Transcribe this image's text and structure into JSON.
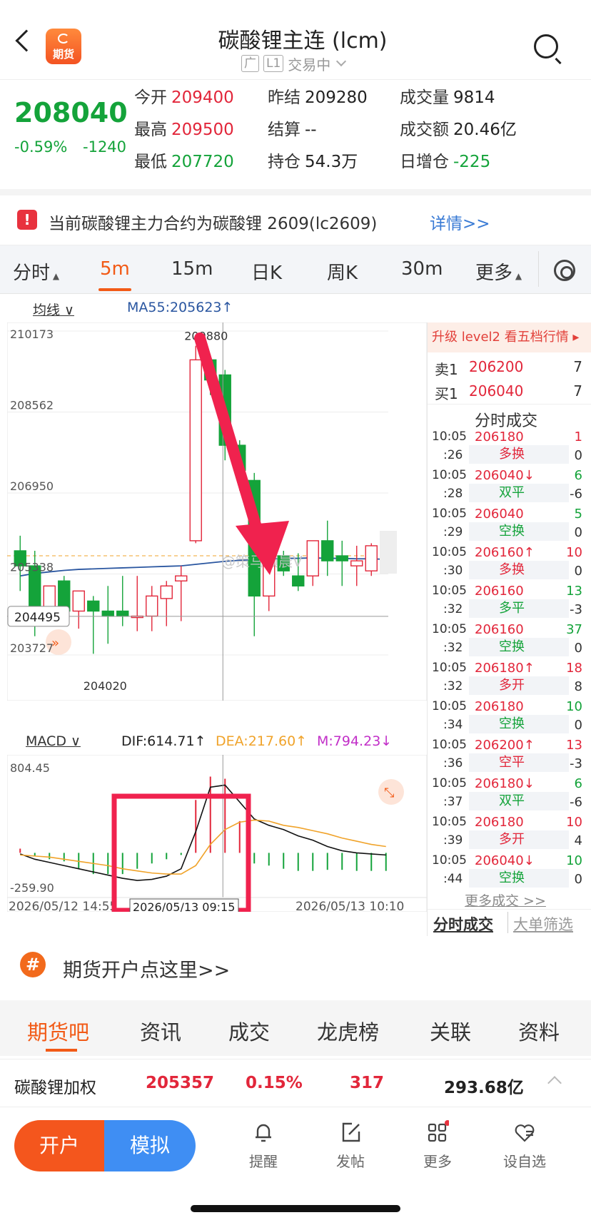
{
  "header": {
    "title": "碳酸锂主连 (lcm)",
    "logo_text": "期货",
    "tag_exchange": "广",
    "tag_level": "L1",
    "status": "交易中"
  },
  "quote": {
    "price": "208040",
    "change_pct": "-0.59%",
    "change_abs": "-1240",
    "open_label": "今开",
    "open": "209400",
    "high_label": "最高",
    "high": "209500",
    "low_label": "最低",
    "low": "207720",
    "prev_label": "昨结",
    "prev": "209280",
    "settle_label": "结算",
    "settle": "--",
    "oi_label": "持仓",
    "oi": "54.3万",
    "vol_label": "成交量",
    "vol": "9814",
    "amount_label": "成交额",
    "amount": "20.46亿",
    "oi_change_label": "日增仓",
    "oi_change": "-225"
  },
  "notice": {
    "text": "当前碳酸锂主力合约为碳酸锂 2609(lc2609)",
    "link": "详情>>"
  },
  "tabs": [
    "分时",
    "5m",
    "15m",
    "日K",
    "周K",
    "30m",
    "更多"
  ],
  "active_tab": "5m",
  "indicators": {
    "ma_label": "均线",
    "ma_value": "MA55:205623↑",
    "macd_label": "MACD",
    "dif": "DIF:614.71↑",
    "dea": "DEA:217.60↑",
    "m": "M:794.23↓"
  },
  "chart_data": {
    "type": "candlestick",
    "y_ticks": [
      "210173",
      "208562",
      "206950",
      "205338",
      "203727"
    ],
    "high_label": "209880",
    "low_label": "204020",
    "cursor_price": "204495",
    "macd_ticks": [
      "804.45",
      "-259.90"
    ],
    "x_labels": [
      "2026/05/12 14:55",
      "2026/05/13 10:10"
    ],
    "cursor_time": "2026/05/13 09:15",
    "watermark": "@策马巅晨V",
    "ylim": [
      203727,
      210173
    ],
    "candles": [
      {
        "o": 205800,
        "h": 206100,
        "c": 205500,
        "l": 205000
      },
      {
        "o": 205500,
        "h": 205800,
        "c": 204500,
        "l": 204100
      },
      {
        "o": 204500,
        "h": 205100,
        "c": 205100,
        "l": 204300
      },
      {
        "o": 205200,
        "h": 205300,
        "c": 204600,
        "l": 204300
      },
      {
        "o": 204600,
        "h": 204850,
        "c": 205000,
        "l": 204250
      },
      {
        "o": 204800,
        "h": 204900,
        "c": 204600,
        "l": 203750
      },
      {
        "o": 204600,
        "h": 205100,
        "c": 204500,
        "l": 203950
      },
      {
        "o": 204600,
        "h": 205300,
        "c": 204500,
        "l": 204300
      },
      {
        "o": 204500,
        "h": 205300,
        "c": 204500,
        "l": 204200
      },
      {
        "o": 204500,
        "h": 205100,
        "c": 204900,
        "l": 204200
      },
      {
        "o": 204850,
        "h": 205200,
        "c": 205100,
        "l": 204300
      },
      {
        "o": 205200,
        "h": 205500,
        "c": 205300,
        "l": 204400
      },
      {
        "o": 206000,
        "h": 209880,
        "c": 209600,
        "l": 205950
      },
      {
        "o": 209600,
        "h": 209700,
        "c": 209200,
        "l": 208900
      },
      {
        "o": 209300,
        "h": 209400,
        "c": 207900,
        "l": 207600
      },
      {
        "o": 207900,
        "h": 208000,
        "c": 207400,
        "l": 207000
      },
      {
        "o": 207200,
        "h": 207350,
        "c": 204900,
        "l": 204100
      },
      {
        "o": 204900,
        "h": 205800,
        "c": 205750,
        "l": 204600
      },
      {
        "o": 205700,
        "h": 205800,
        "c": 205400,
        "l": 205300
      },
      {
        "o": 205300,
        "h": 205750,
        "c": 205100,
        "l": 205000
      },
      {
        "o": 205300,
        "h": 206000,
        "c": 206000,
        "l": 205100
      },
      {
        "o": 206000,
        "h": 206400,
        "c": 205600,
        "l": 205300
      },
      {
        "o": 205700,
        "h": 206000,
        "c": 205600,
        "l": 205100
      },
      {
        "o": 205500,
        "h": 205900,
        "c": 205600,
        "l": 205100
      },
      {
        "o": 205400,
        "h": 205950,
        "c": 205900,
        "l": 205300
      },
      {
        "o": 205900,
        "h": 206000,
        "c": 205700,
        "l": 205600
      }
    ],
    "ma55": [
      205300,
      205350,
      205380,
      205410,
      205430,
      205440,
      205450,
      205460,
      205470,
      205480,
      205490,
      205500,
      205530,
      205560,
      205590,
      205610,
      205625,
      205640,
      205650,
      205650,
      205660,
      205650,
      205650,
      205640,
      205640,
      205630
    ],
    "macd_ylim": [
      -259.9,
      804.45
    ],
    "dif": [
      -10,
      -60,
      -90,
      -120,
      -150,
      -180,
      -210,
      -240,
      -260,
      -250,
      -220,
      -150,
      200,
      620,
      640,
      480,
      320,
      260,
      220,
      160,
      120,
      60,
      20,
      0,
      -10,
      -20
    ],
    "dea": [
      -20,
      -30,
      -40,
      -60,
      -80,
      -100,
      -120,
      -150,
      -170,
      -190,
      -200,
      -200,
      -120,
      80,
      220,
      290,
      310,
      300,
      260,
      240,
      210,
      180,
      140,
      110,
      80,
      60
    ],
    "macd_bars": [
      40,
      -30,
      -60,
      -80,
      -150,
      -200,
      -200,
      -200,
      -150,
      -100,
      -60,
      -20,
      500,
      720,
      700,
      300,
      -100,
      -120,
      -150,
      -170,
      -170,
      -160,
      -160,
      -170,
      -170,
      -170
    ]
  },
  "side": {
    "upgrade": "升级 level2 看五档行情 ▸",
    "sell_label": "卖1",
    "sell_price": "206200",
    "sell_vol": "7",
    "buy_label": "买1",
    "buy_price": "206040",
    "buy_vol": "7",
    "trades_title": "分时成交",
    "trades": [
      {
        "time": "10:05",
        "sec": ":26",
        "price": "206180",
        "vol": "1",
        "type": "多换",
        "chg": "0",
        "vol_color": "red",
        "type_color": "red"
      },
      {
        "time": "10:05",
        "sec": ":28",
        "price": "206040↓",
        "vol": "6",
        "type": "双平",
        "chg": "-6",
        "vol_color": "green",
        "type_color": "green"
      },
      {
        "time": "10:05",
        "sec": ":29",
        "price": "206040",
        "vol": "5",
        "type": "空换",
        "chg": "0",
        "vol_color": "green",
        "type_color": "green"
      },
      {
        "time": "10:05",
        "sec": ":30",
        "price": "206160↑",
        "vol": "10",
        "type": "多换",
        "chg": "0",
        "vol_color": "red",
        "type_color": "red"
      },
      {
        "time": "10:05",
        "sec": ":32",
        "price": "206160",
        "vol": "13",
        "type": "多平",
        "chg": "-3",
        "vol_color": "green",
        "type_color": "green"
      },
      {
        "time": "10:05",
        "sec": ":32",
        "price": "206160",
        "vol": "37",
        "type": "空换",
        "chg": "0",
        "vol_color": "green",
        "type_color": "green"
      },
      {
        "time": "10:05",
        "sec": ":32",
        "price": "206180↑",
        "vol": "18",
        "type": "多开",
        "chg": "8",
        "vol_color": "red",
        "type_color": "red"
      },
      {
        "time": "10:05",
        "sec": ":34",
        "price": "206180",
        "vol": "10",
        "type": "空换",
        "chg": "0",
        "vol_color": "green",
        "type_color": "green"
      },
      {
        "time": "10:05",
        "sec": ":36",
        "price": "206200↑",
        "vol": "13",
        "type": "空平",
        "chg": "-3",
        "vol_color": "red",
        "type_color": "red"
      },
      {
        "time": "10:05",
        "sec": ":37",
        "price": "206180↓",
        "vol": "6",
        "type": "双平",
        "chg": "-6",
        "vol_color": "green",
        "type_color": "green"
      },
      {
        "time": "10:05",
        "sec": ":39",
        "price": "206180",
        "vol": "10",
        "type": "多开",
        "chg": "4",
        "vol_color": "red",
        "type_color": "red"
      },
      {
        "time": "10:05",
        "sec": ":44",
        "price": "206040↓",
        "vol": "10",
        "type": "空换",
        "chg": "0",
        "vol_color": "green",
        "type_color": "green"
      }
    ],
    "more_trades": "更多成交 >>",
    "tab_trades": "分时成交",
    "tab_big": "大单筛选"
  },
  "open_account": "期货开户点这里>>",
  "section_tabs": [
    "期货吧",
    "资讯",
    "成交",
    "龙虎榜",
    "关联",
    "资料"
  ],
  "index_row": {
    "name": "碳酸锂加权",
    "price": "205357",
    "pct": "0.15%",
    "change": "317",
    "amount": "293.68亿"
  },
  "bottom_nav": {
    "open": "开户",
    "sim": "模拟",
    "items": [
      "提醒",
      "发帖",
      "更多",
      "设自选"
    ]
  },
  "colors": {
    "up": "#e2263a",
    "down": "#14a33a",
    "accent": "#f25a16",
    "ma55": "#2a56a0",
    "dea": "#f0a32a"
  }
}
